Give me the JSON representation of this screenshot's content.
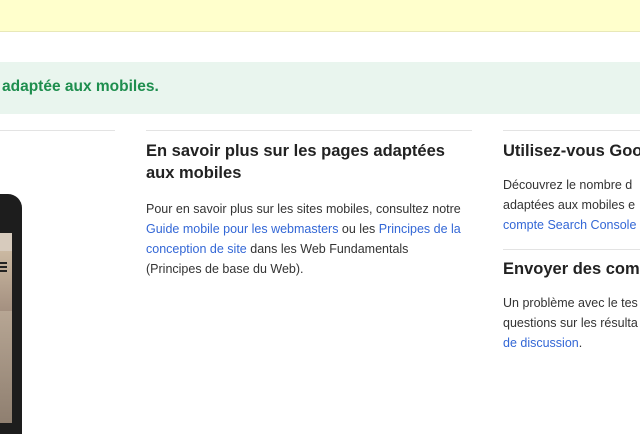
{
  "banner": {
    "text": "adaptée aux mobiles."
  },
  "learn_more": {
    "title": "En savoir plus sur les pages adaptées aux mobiles",
    "para_part1": "Pour en savoir plus sur les sites mobiles, consultez notre ",
    "link_guide": "Guide mobile pour les webmasters",
    "para_part2": " ou les ",
    "link_principles": "Principes de la conception de site",
    "para_part3": " dans les Web Fundamentals (Principes de base du Web)."
  },
  "search_console": {
    "title": "Utilisez-vous Goo",
    "line1": "Découvrez le nombre d",
    "line2": "adaptées aux mobiles e",
    "link": "compte Search Console"
  },
  "feedback": {
    "title": "Envoyer des com",
    "line1": "Un problème avec le tes",
    "line2": "questions sur les résulta",
    "link": "de discussion",
    "after_link": "."
  }
}
